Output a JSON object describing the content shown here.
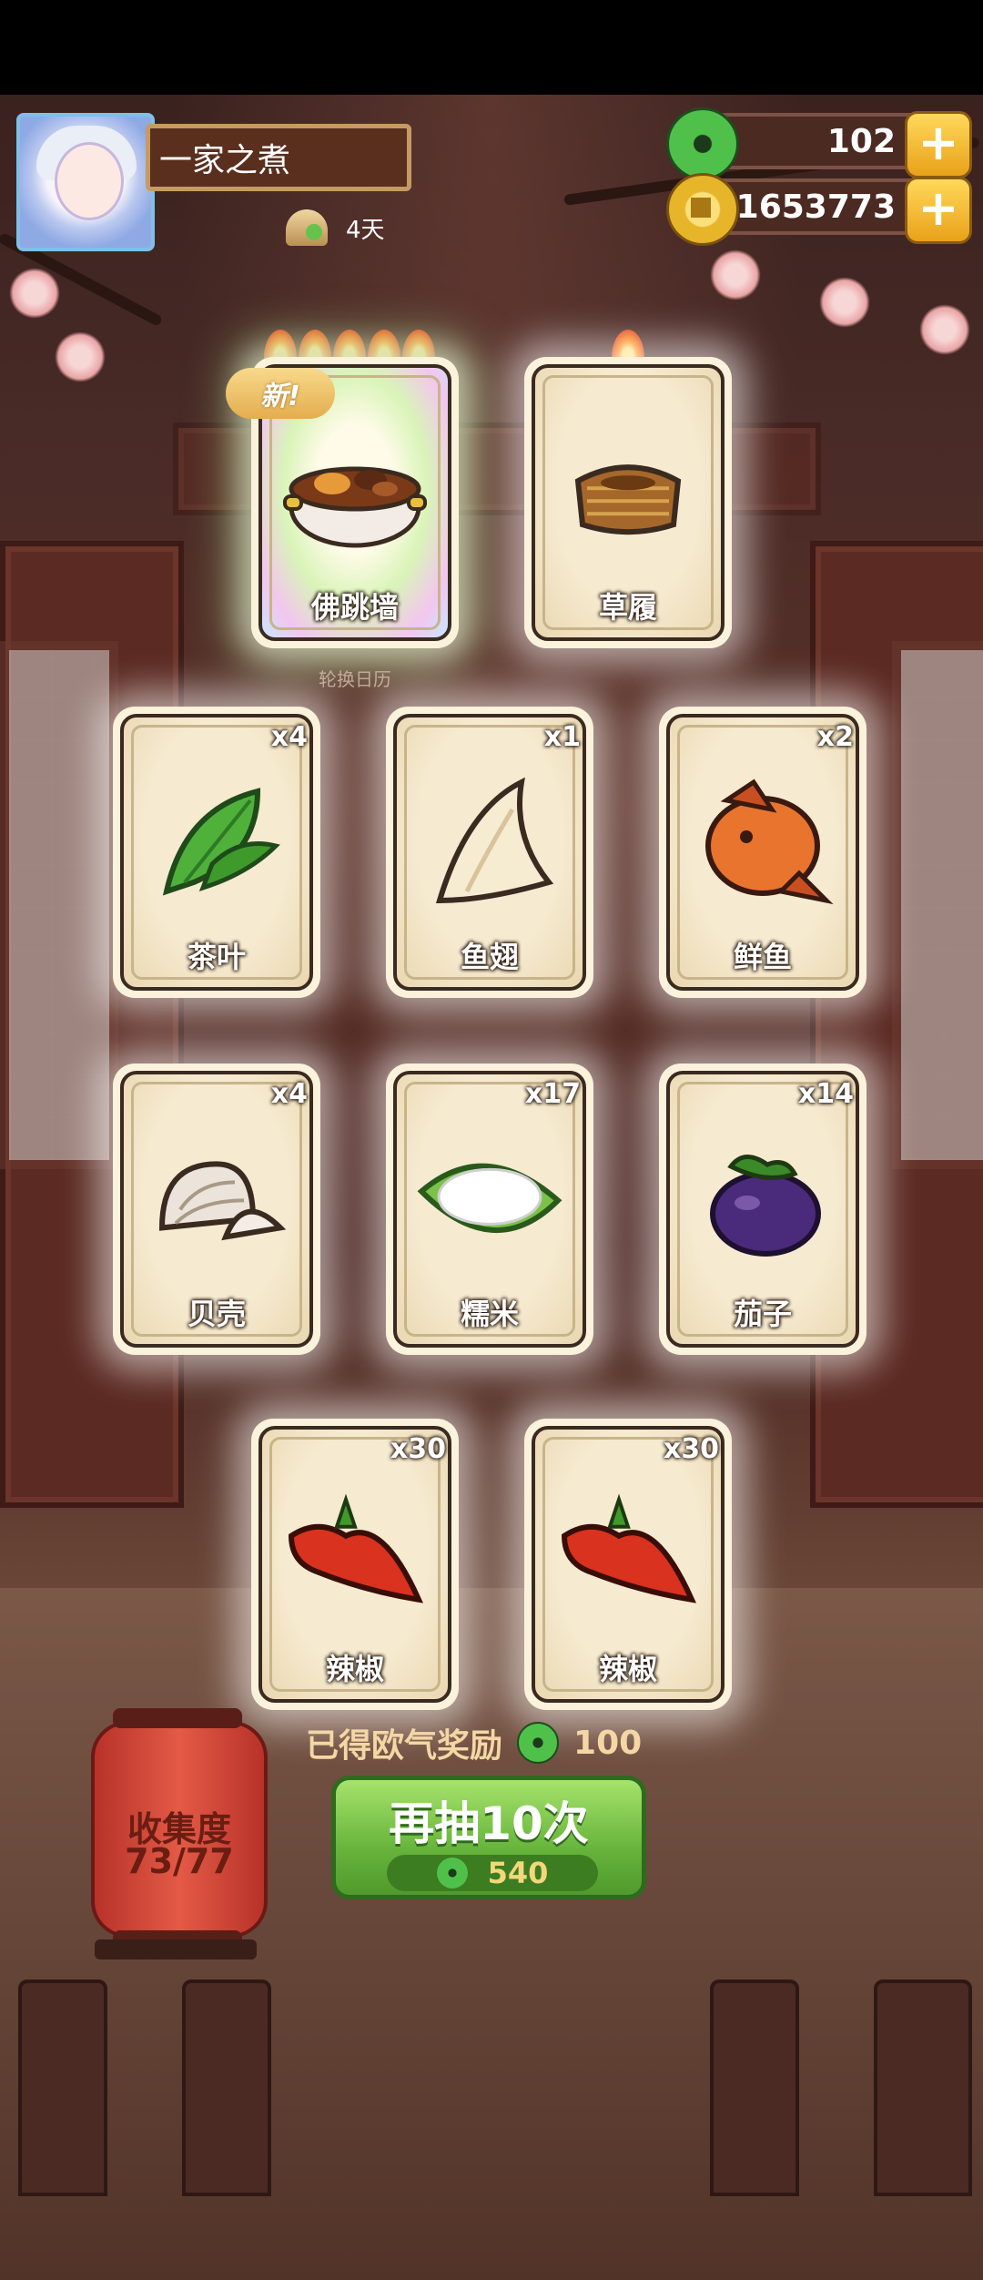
{
  "header": {
    "player_name": "一家之煮",
    "days": "4天",
    "jade": "102",
    "coins": "1653773"
  },
  "featured_cards": [
    {
      "label": "佛跳墙",
      "icon": "buddha-jumps-over-wall-icon",
      "flames": 5,
      "tag": "新!"
    },
    {
      "label": "草履",
      "icon": "straw-sandal-icon",
      "flames": 1
    }
  ],
  "rotate_label": "轮换日历",
  "cards": [
    {
      "label": "茶叶",
      "qty": "x4",
      "icon": "tea-leaf-icon"
    },
    {
      "label": "鱼翅",
      "qty": "x1",
      "icon": "shark-fin-icon"
    },
    {
      "label": "鲜鱼",
      "qty": "x2",
      "icon": "fresh-fish-icon"
    },
    {
      "label": "贝壳",
      "qty": "x4",
      "icon": "clam-shell-icon"
    },
    {
      "label": "糯米",
      "qty": "x17",
      "icon": "glutinous-rice-icon"
    },
    {
      "label": "茄子",
      "qty": "x14",
      "icon": "eggplant-icon"
    },
    {
      "label": "辣椒",
      "qty": "x30",
      "icon": "chili-pepper-icon"
    },
    {
      "label": "辣椒",
      "qty": "x30",
      "icon": "chili-pepper-icon"
    }
  ],
  "reward": {
    "text": "已得欧气奖励",
    "value": "100"
  },
  "collection": {
    "title": "收集度",
    "progress": "73/77"
  },
  "draw_button": {
    "label": "再抽10次",
    "cost": "540"
  },
  "colors": {
    "accent_green": "#67b43c",
    "lantern_red": "#e35a45",
    "card_bg": "#fbf2dc"
  }
}
